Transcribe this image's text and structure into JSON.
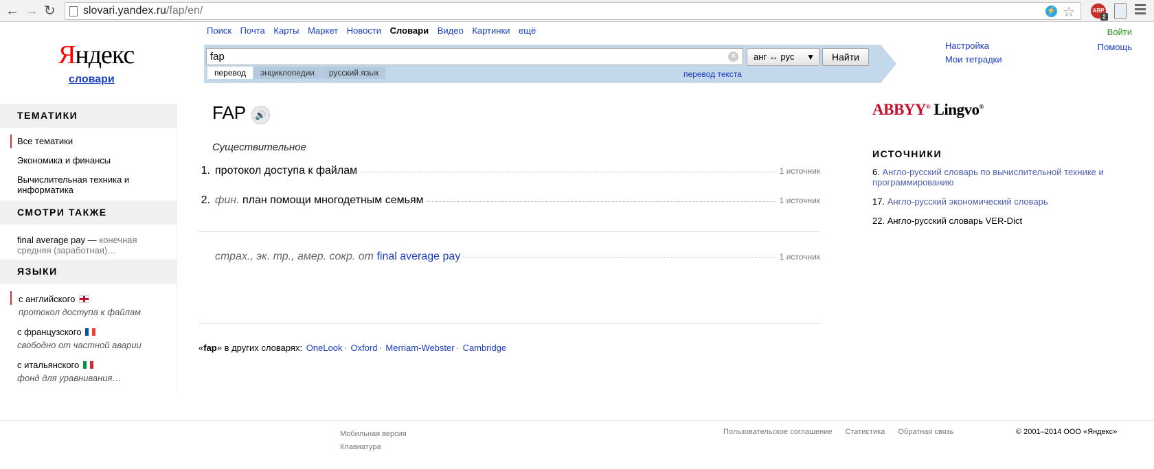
{
  "browser": {
    "url_host": "slovari.yandex.ru",
    "url_path": "/fap/en/",
    "back_icon": "arrow-left",
    "forward_icon": "arrow-right",
    "reload_icon": "reload",
    "abp_label": "ABP",
    "abp_count": "2"
  },
  "logo": {
    "first": "Я",
    "rest": "ндекс",
    "sub": "словари"
  },
  "services": [
    "Поиск",
    "Почта",
    "Карты",
    "Маркет",
    "Новости",
    "Словари",
    "Видео",
    "Картинки",
    "ещё"
  ],
  "search": {
    "value": "fap",
    "lang": "анг ↔ рус",
    "button": "Найти",
    "tabs": [
      "перевод",
      "энциклопедии",
      "русский язык"
    ],
    "text_link": "перевод текста"
  },
  "settings_links": [
    "Настройка",
    "Мои тетрадки"
  ],
  "user": {
    "login": "Войти",
    "help": "Помощь"
  },
  "sidebar": {
    "topics_head": "ТЕМАТИКИ",
    "topics": [
      "Все тематики",
      "Экономика и финансы",
      "Вычислительная техника и информатика"
    ],
    "see_also_head": "СМОТРИ ТАКЖЕ",
    "see_also": {
      "term": "final average pay",
      "dash": " — ",
      "def": "конечная средняя (заработная)…"
    },
    "langs_head": "ЯЗЫКИ",
    "langs": [
      {
        "label": "с английского",
        "hint": "протокол доступа к файлам"
      },
      {
        "label": "с французского",
        "hint": "свободно от частной аварии"
      },
      {
        "label": "с итальянского",
        "hint": "фонд для уравнивания…"
      }
    ]
  },
  "main": {
    "headword": "FAP",
    "pos": "Существительное",
    "entries": [
      {
        "num": "1.",
        "label": "",
        "text": "протокол доступа к файлам",
        "source": "1 источник"
      },
      {
        "num": "2.",
        "label": "фин.",
        "text": "план помощи многодетным семьям",
        "source": "1 источник"
      }
    ],
    "abbrev": {
      "label": "страх., эк. тр., амер. сокр. от",
      "link": "final average pay",
      "source": "1 источник"
    },
    "other_prefix": "«",
    "other_word": "fap",
    "other_suffix": "» в других словарях:",
    "other_dicts": [
      "OneLook",
      "Oxford",
      "Merriam-Webster",
      "Cambridge"
    ]
  },
  "right": {
    "abbyy": "ABBYY",
    "lingvo": "Lingvo",
    "sources_head": "ИСТОЧНИКИ",
    "sources": [
      {
        "n": "6.",
        "name": "Англо-русский словарь по вычислительной технике и программированию"
      },
      {
        "n": "17.",
        "name": "Англо-русский экономический словарь"
      },
      {
        "n": "22.",
        "name": "Англо-русский словарь VER-Dict"
      }
    ]
  },
  "footer": {
    "mobile": "Мобильная версия",
    "keyboard": "Клавиатура",
    "links": [
      "Пользовательское соглашение",
      "Статистика",
      "Обратная связь"
    ],
    "copyright": "© 2001–2014  ООО «",
    "company": "Яндекс",
    "copyright_end": "»"
  }
}
